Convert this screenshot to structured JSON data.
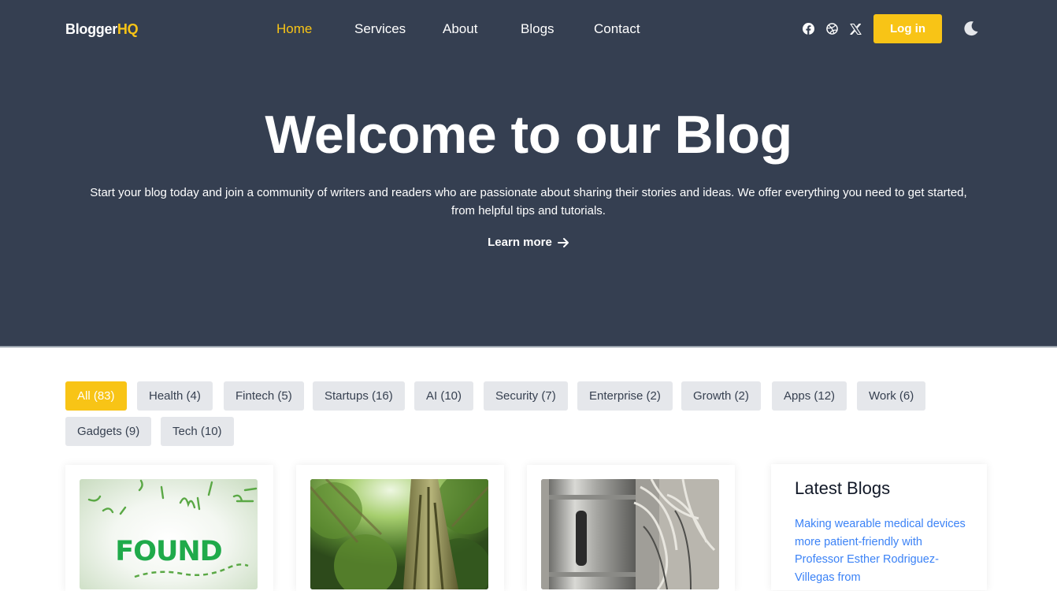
{
  "brand": {
    "name_main": "Blogger",
    "name_accent": "HQ"
  },
  "nav": {
    "items": [
      "Home",
      "Services",
      "About",
      "Blogs",
      "Contact"
    ],
    "active": "Home"
  },
  "header": {
    "login_label": "Log in",
    "social_icons": [
      "facebook-icon",
      "dribbble-icon",
      "x-icon"
    ],
    "theme_icon": "moon-icon"
  },
  "hero": {
    "title": "Welcome to our Blog",
    "text": "Start your blog today and join a community of writers and readers who are passionate about sharing their stories and ideas. We offer everything you need to get started, from helpful tips and tutorials.",
    "cta": "Learn more"
  },
  "categories": [
    "All (83)",
    "Health (4)",
    "Fintech (5)",
    "Startups (16)",
    "AI (10)",
    "Security (7)",
    "Enterprise (2)",
    "Growth (2)",
    "Apps (12)",
    "Work (6)",
    "Gadgets (9)",
    "Tech (10)"
  ],
  "active_category": "All (83)",
  "cards": [
    {
      "image_text": "FOUND"
    },
    {
      "image": "forest-photo"
    },
    {
      "image": "lab-equipment-photo"
    }
  ],
  "sidebar": {
    "title": "Latest Blogs",
    "link": "Making wearable medical devices more patient-friendly with Professor Esther Rodriguez-Villegas from"
  },
  "colors": {
    "accent": "#f8c416",
    "hero_bg": "#353f51",
    "link": "#3b82f6",
    "chip_bg": "#e5e7eb"
  }
}
